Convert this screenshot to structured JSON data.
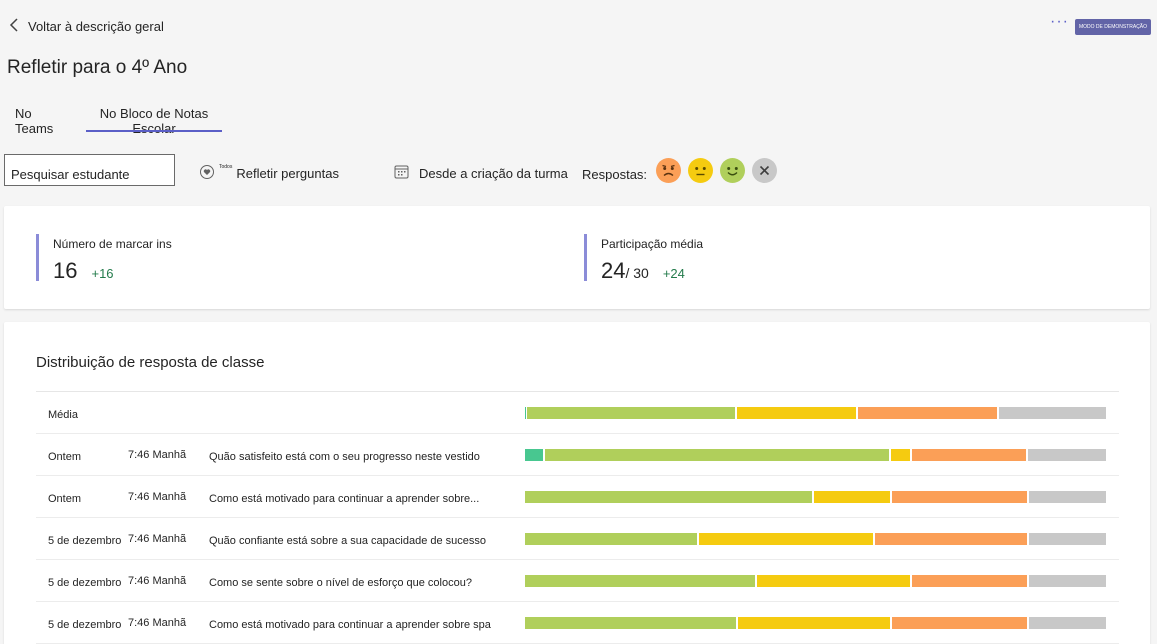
{
  "nav": {
    "back_label": "Voltar à descrição geral",
    "demo_badge": "MODO DE DEMONSTRAÇÃO",
    "more_icon": "ellipsis-icon"
  },
  "page": {
    "title": "Refletir para o 4º Ano"
  },
  "tabs": [
    {
      "label": "No Teams",
      "active": false
    },
    {
      "label": "No Bloco de Notas Escolar",
      "active": true
    }
  ],
  "filters": {
    "search_placeholder": "Pesquisar estudante",
    "questions_prefix": "Todos",
    "questions_label": "Refletir perguntas",
    "date_label": "Desde a criação da turma",
    "responses_label": "Respostas:",
    "response_icons": [
      "sad-face-icon",
      "neutral-face-icon",
      "happy-face-icon",
      "close-icon"
    ]
  },
  "stats": [
    {
      "label": "Número de marcar ins",
      "value": "16",
      "suffix": "",
      "delta": "+16"
    },
    {
      "label": "Participação média",
      "value": "24",
      "suffix": "/ 30",
      "delta": "+24"
    }
  ],
  "distribution": {
    "title": "Distribuição de resposta de classe",
    "colors": {
      "teal": "#48c790",
      "green": "#b0cf5b",
      "yellow": "#f5cb10",
      "orange": "#fb9f57",
      "grey": "#c8c8c8"
    },
    "rows": [
      {
        "date": "Média",
        "time": "",
        "question": "",
        "shares": [
          0.3,
          36.0,
          20.9,
          24.1,
          18.7
        ]
      },
      {
        "date": "Ontem",
        "time": "7:46 Manhã",
        "question": "Quão satisfeito está com o seu progresso neste vestido",
        "shares": [
          3.4,
          59.4,
          3.6,
          19.8,
          13.8
        ]
      },
      {
        "date": "Ontem",
        "time": "7:46 Manhã",
        "question": "Como está motivado para continuar a aprender sobre...",
        "shares": [
          0,
          49.9,
          13.5,
          23.6,
          13.6
        ]
      },
      {
        "date": "5 de dezembro",
        "time": "7:46 Manhã",
        "question": "Quão confiante está sobre a sua capacidade de sucesso",
        "shares": [
          0,
          30.0,
          30.2,
          26.6,
          13.6
        ]
      },
      {
        "date": "5 de dezembro",
        "time": "7:46 Manhã",
        "question": "Como se sente sobre o nível de esforço que colocou?",
        "shares": [
          0,
          39.9,
          26.6,
          20.2,
          13.6
        ]
      },
      {
        "date": "5 de dezembro",
        "time": "7:46 Manhã",
        "question": "Como está motivado para continuar a aprender sobre spa",
        "shares": [
          0,
          36.6,
          26.6,
          23.6,
          13.6
        ]
      }
    ]
  }
}
